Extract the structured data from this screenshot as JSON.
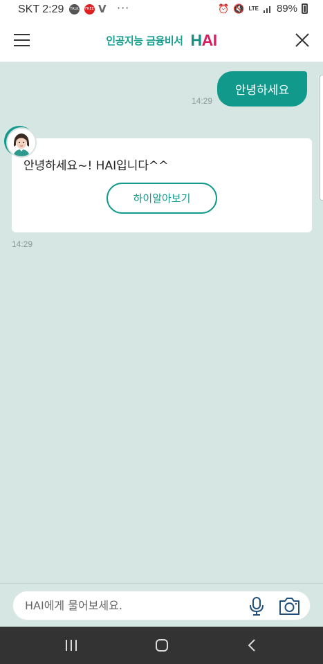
{
  "status_bar": {
    "carrier_time": "SKT 2:29",
    "notif_talk": "TALK",
    "notif_free": "FREE",
    "notif_v": "V",
    "more": "···",
    "lte": "LTE",
    "battery": "89%"
  },
  "header": {
    "subtitle": "인공지능 금융비서",
    "logo_h": "H",
    "logo_ai": "AI"
  },
  "chat": {
    "user_message": "안녕하세요",
    "user_time": "14:29",
    "bot_message": "안녕하세요~! HAI입니다^^",
    "bot_button": "하이알아보기",
    "bot_time": "14:29"
  },
  "input": {
    "placeholder": "HAI에게 물어보세요."
  },
  "colors": {
    "accent": "#11998c",
    "logo_pink": "#d81e5b",
    "chat_bg": "#d6e6e3",
    "nav_bg": "#333333"
  },
  "icons": [
    "menu-icon",
    "close-icon",
    "microphone-icon",
    "camera-icon",
    "recent-apps-icon",
    "home-icon",
    "back-icon"
  ]
}
